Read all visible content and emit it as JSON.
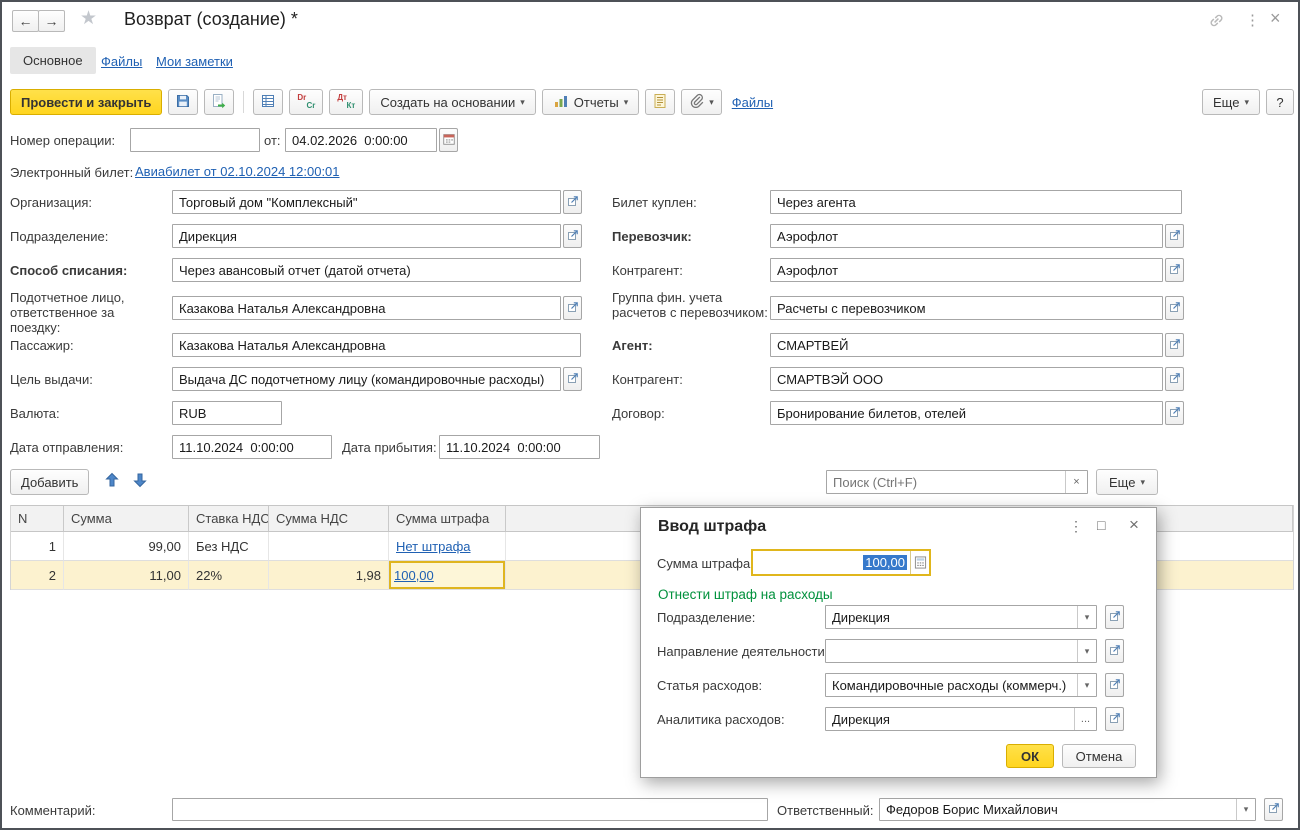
{
  "icons": {
    "back": "←",
    "forward": "→",
    "star": "★",
    "ellipsis": "⋮",
    "close": "×",
    "caret": "▾",
    "clear": "×",
    "maximize": "□",
    "dots": "...",
    "dr": "Dr",
    "cr": "Cr",
    "dt": "Дт",
    "kt": "Кт"
  },
  "titlebar": {
    "title": "Возврат (создание) *"
  },
  "tabs": {
    "main": "Основное",
    "files": "Файлы",
    "notes": "Мои заметки"
  },
  "toolbar": {
    "post_and_close": "Провести и закрыть",
    "create_based_on": "Создать на основании",
    "reports": "Отчеты",
    "files_link": "Файлы",
    "more": "Еще",
    "help": "?"
  },
  "form": {
    "operation_number": {
      "label": "Номер операции:",
      "value": ""
    },
    "from_date": {
      "label": "от:",
      "value": "04.02.2026  0:00:00"
    },
    "eticket": {
      "label": "Электронный билет:",
      "link": "Авиабилет от 02.10.2024 12:00:01"
    },
    "organization": {
      "label": "Организация:",
      "value": "Торговый дом \"Комплексный\""
    },
    "department": {
      "label": "Подразделение:",
      "value": "Дирекция"
    },
    "writeoff_method": {
      "label": "Способ списания:",
      "value": "Через авансовый отчет (датой отчета)"
    },
    "accountable_person": {
      "label": "Подотчетное лицо, ответственное за поездку:",
      "value": "Казакова Наталья Александровна"
    },
    "passenger": {
      "label": "Пассажир:",
      "value": "Казакова Наталья Александровна"
    },
    "issue_purpose": {
      "label": "Цель выдачи:",
      "value": "Выдача ДС подотчетному лицу (командировочные расходы)"
    },
    "currency": {
      "label": "Валюта:",
      "value": "RUB"
    },
    "departure_date": {
      "label": "Дата отправления:",
      "value": "11.10.2024  0:00:00"
    },
    "arrival_date": {
      "label": "Дата прибытия:",
      "value": "11.10.2024  0:00:00"
    },
    "ticket_bought": {
      "label": "Билет куплен:",
      "value": "Через агента"
    },
    "carrier": {
      "label": "Перевозчик:",
      "value": "Аэрофлот"
    },
    "carrier_counterparty": {
      "label": "Контрагент:",
      "value": "Аэрофлот"
    },
    "fin_group": {
      "label": "Группа фин. учета расчетов с перевозчиком:",
      "value": "Расчеты с перевозчиком"
    },
    "agent": {
      "label": "Агент:",
      "value": "СМАРТВЕЙ"
    },
    "agent_counterparty": {
      "label": "Контрагент:",
      "value": "СМАРТВЭЙ ООО"
    },
    "contract": {
      "label": "Договор:",
      "value": "Бронирование билетов, отелей"
    }
  },
  "commandbar": {
    "add": "Добавить",
    "search_placeholder": "Поиск (Ctrl+F)",
    "more": "Еще"
  },
  "table": {
    "headers": {
      "n": "N",
      "sum": "Сумма",
      "vat_rate": "Ставка НДС",
      "vat_sum": "Сумма НДС",
      "penalty": "Сумма штрафа"
    },
    "rows": [
      {
        "n": "1",
        "sum": "99,00",
        "vat_rate": "Без НДС",
        "vat_sum": "",
        "penalty": "Нет штрафа"
      },
      {
        "n": "2",
        "sum": "11,00",
        "vat_rate": "22%",
        "vat_sum": "1,98",
        "penalty": "100,00"
      }
    ]
  },
  "dialog": {
    "title": "Ввод штрафа",
    "penalty": {
      "label": "Сумма штрафа:",
      "value": "100,00"
    },
    "section_header": "Отнести штраф на расходы",
    "department": {
      "label": "Подразделение:",
      "value": "Дирекция"
    },
    "activity": {
      "label": "Направление деятельности:",
      "value": ""
    },
    "expense_item": {
      "label": "Статья расходов:",
      "value": "Командировочные расходы (коммерч.)"
    },
    "analytics": {
      "label": "Аналитика расходов:",
      "value": "Дирекция"
    },
    "ok": "ОК",
    "cancel": "Отмена"
  },
  "footer": {
    "comment": {
      "label": "Комментарий:",
      "value": ""
    },
    "responsible": {
      "label": "Ответственный:",
      "value": "Федоров Борис Михайлович"
    }
  },
  "colors": {
    "accent_yellow": "#FFD72E",
    "link_blue": "#2061B3",
    "selected_row": "#FCF2CF",
    "selected_cell_border": "#DFB520",
    "section_green": "#00913C"
  }
}
